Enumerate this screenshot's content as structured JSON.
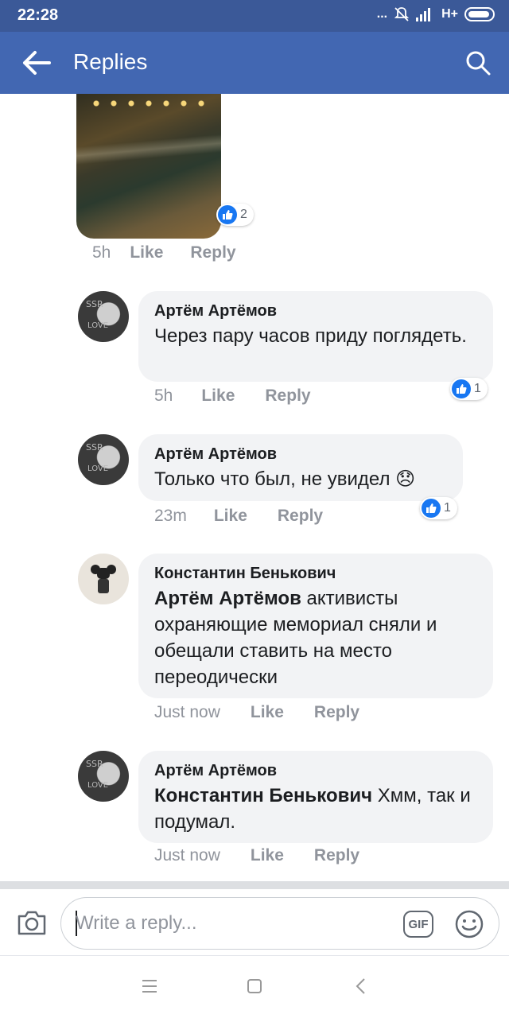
{
  "status": {
    "time": "22:28",
    "network": "H+",
    "dots": "..."
  },
  "header": {
    "title": "Replies"
  },
  "colors": {
    "header": "#4267b2",
    "statusbar": "#3b5998",
    "like_blue": "#1877f2",
    "bubble_bg": "#f2f3f5"
  },
  "photo_comment": {
    "reactions": "2",
    "time": "5h",
    "like": "Like",
    "reply": "Reply"
  },
  "comments": [
    {
      "author": "Артём Артёмов",
      "mention": "",
      "text": "Через пару часов приду поглядеть.",
      "reactions": "1",
      "time": "5h",
      "like": "Like",
      "reply": "Reply"
    },
    {
      "author": "Артём Артёмов",
      "mention": "",
      "text": "Только что был, не увидел 😞",
      "reactions": "1",
      "time": "23m",
      "like": "Like",
      "reply": "Reply"
    },
    {
      "author": "Константин Бенькович",
      "mention": "Артём Артёмов",
      "text": " активисты охраняющие мемориал сняли и обещали ставить на место переодически",
      "reactions": "",
      "time": "Just now",
      "like": "Like",
      "reply": "Reply"
    },
    {
      "author": "Артём Артёмов",
      "mention": "Константин Бенькович",
      "text": " Хмм, так и подумал.",
      "reactions": "",
      "time": "Just now",
      "like": "Like",
      "reply": "Reply"
    }
  ],
  "composer": {
    "placeholder": "Write a reply...",
    "gif": "GIF"
  },
  "icons": [
    "back-arrow-icon",
    "search-icon",
    "like-thumb-icon",
    "camera-icon",
    "gif-icon",
    "emoji-icon",
    "nav-menu-icon",
    "nav-home-icon",
    "nav-back-icon"
  ]
}
